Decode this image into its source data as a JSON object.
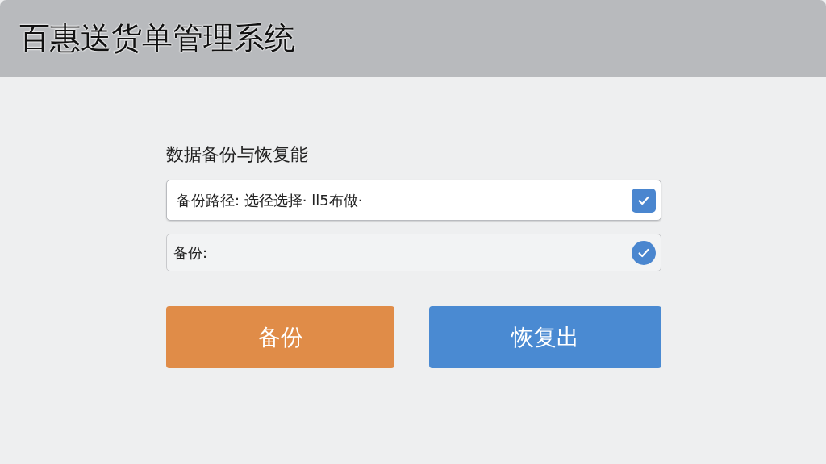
{
  "window": {
    "title": "百惠送货单管理系统"
  },
  "panel": {
    "heading": "数据备份与恢复能",
    "rows": [
      {
        "kind": "box",
        "label": "备份路径: 选径选择· ll5布做·",
        "checked": true
      },
      {
        "kind": "round",
        "label": "备份:",
        "checked": true
      }
    ],
    "buttons": [
      {
        "kind": "orange",
        "label": "备份"
      },
      {
        "kind": "blue",
        "label": "恢复出"
      }
    ]
  }
}
